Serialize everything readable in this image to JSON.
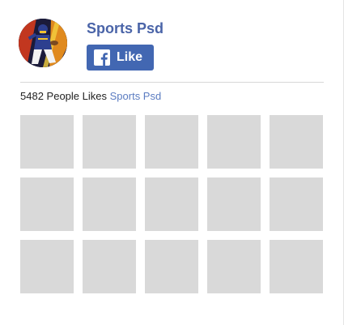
{
  "page": {
    "name": "Sports Psd",
    "avatar_icon": "football-player-avatar-icon"
  },
  "like_button": {
    "label": "Like",
    "icon": "facebook-icon",
    "color": "#4267b2"
  },
  "likes": {
    "count": "5482",
    "text": "People Likes",
    "page_link": "Sports Psd"
  },
  "grid": {
    "rows": 3,
    "columns": 5,
    "tile_color": "#d9d9d9"
  }
}
